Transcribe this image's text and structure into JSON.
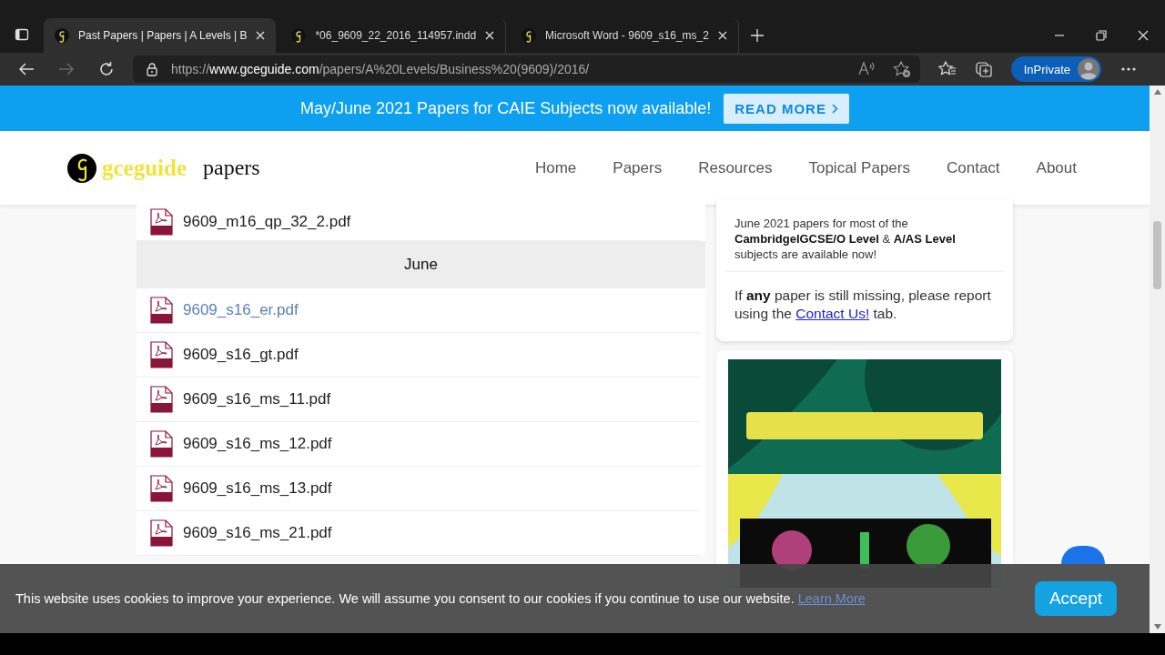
{
  "browser": {
    "tabs": [
      {
        "title": "Past Papers | Papers | A Levels | B",
        "selected": true
      },
      {
        "title": "*06_9609_22_2016_114957.indd",
        "selected": false
      },
      {
        "title": "Microsoft Word - 9609_s16_ms_2",
        "selected": false
      }
    ],
    "url_scheme": "https://",
    "url_host": "www.gceguide.com",
    "url_path": "/papers/A%20Levels/Business%20(9609)/2016/",
    "profile_label": "InPrivate"
  },
  "banner": {
    "text": "May/June 2021 Papers for CAIE Subjects now available!",
    "button": "READ MORE"
  },
  "site_header": {
    "logo_text": "gceguide",
    "logo_suffix": "papers",
    "nav": [
      {
        "label": "Home"
      },
      {
        "label": "Papers"
      },
      {
        "label": "Resources"
      },
      {
        "label": "Topical Papers"
      },
      {
        "label": "Contact"
      },
      {
        "label": "About"
      }
    ]
  },
  "files": [
    {
      "kind": "file",
      "name": "9609_m16_qp_32_2.pdf",
      "hovered": false
    },
    {
      "kind": "heading",
      "name": "June"
    },
    {
      "kind": "file",
      "name": "9609_s16_er.pdf",
      "hovered": true
    },
    {
      "kind": "file",
      "name": "9609_s16_gt.pdf",
      "hovered": false
    },
    {
      "kind": "file",
      "name": "9609_s16_ms_11.pdf",
      "hovered": false
    },
    {
      "kind": "file",
      "name": "9609_s16_ms_12.pdf",
      "hovered": false
    },
    {
      "kind": "file",
      "name": "9609_s16_ms_13.pdf",
      "hovered": false
    },
    {
      "kind": "file",
      "name": "9609_s16_ms_21.pdf",
      "hovered": false
    }
  ],
  "sidebar": {
    "notice": "June 2021 papers for most of the **CambridgeIGCSE/O Level** & **A/AS Level** subjects are available now!",
    "missing_before": "If **any** paper is still missing, please report using the ",
    "missing_link": "Contact Us!",
    "missing_after": " tab."
  },
  "cookie_bar": {
    "text": "This website uses cookies to improve your experience. We will assume you consent to our cookies if you continue to use our website.",
    "link": "Learn More",
    "button": "Accept"
  }
}
